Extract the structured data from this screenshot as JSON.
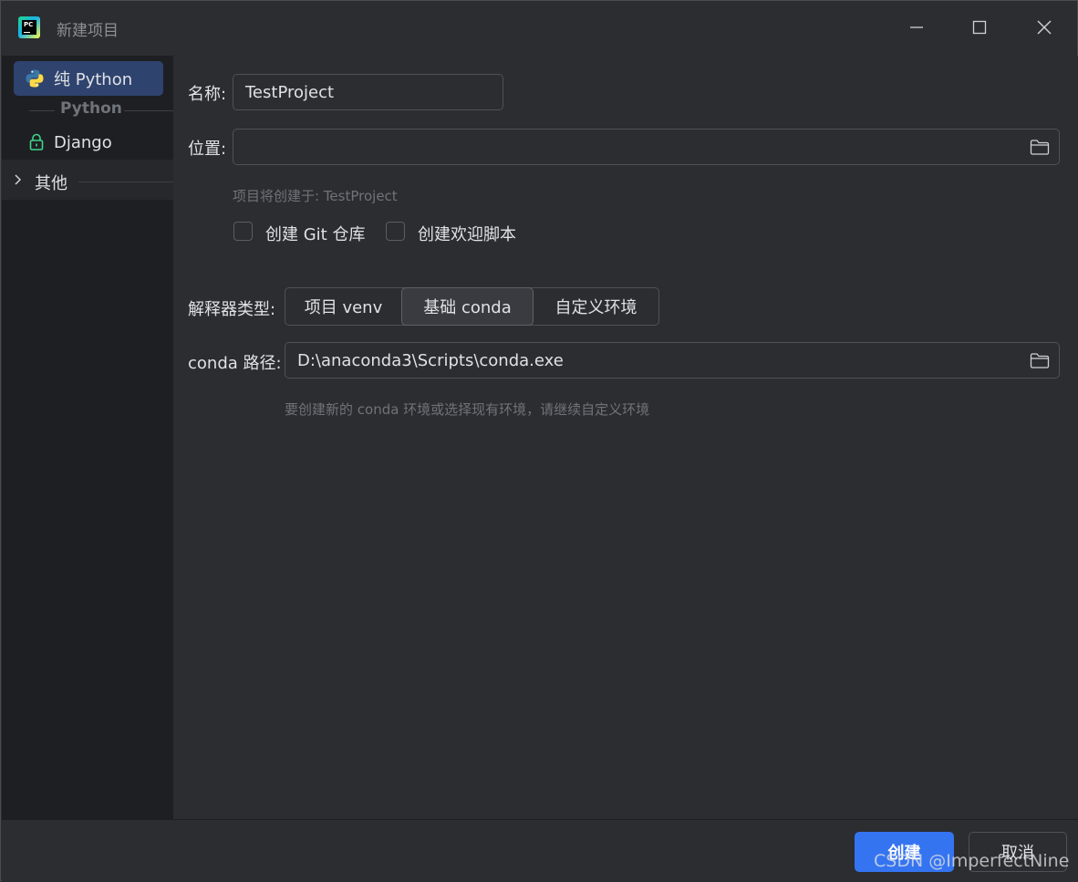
{
  "window": {
    "title": "新建项目"
  },
  "sidebar": {
    "items": [
      {
        "label": "纯 Python",
        "icon": "python-icon",
        "selected": true
      },
      {
        "label": "Django",
        "icon": "lock-icon",
        "selected": false
      }
    ],
    "group_header": "Python",
    "other_label": "其他"
  },
  "form": {
    "name_label": "名称:",
    "name_value": "TestProject",
    "location_label": "位置:",
    "location_value": "",
    "create_hint": "项目将创建于: TestProject",
    "git_checkbox_label": "创建 Git 仓库",
    "git_checked": false,
    "welcome_checkbox_label": "创建欢迎脚本",
    "welcome_checked": false,
    "interpreter_type_label": "解释器类型:",
    "interpreter_options": [
      "项目 venv",
      "基础 conda",
      "自定义环境"
    ],
    "interpreter_selected": "基础 conda",
    "conda_path_label": "conda 路径:",
    "conda_path_value": "D:\\anaconda3\\Scripts\\conda.exe",
    "conda_hint": "要创建新的 conda 环境或选择现有环境，请继续自定义环境"
  },
  "footer": {
    "create_label": "创建",
    "cancel_label": "取消"
  },
  "watermark": "CSDN @ImperfectNine",
  "colors": {
    "accent": "#3574f0",
    "selection": "#2e436e",
    "background": "#2b2d30",
    "sidebar": "#1e1f22"
  }
}
